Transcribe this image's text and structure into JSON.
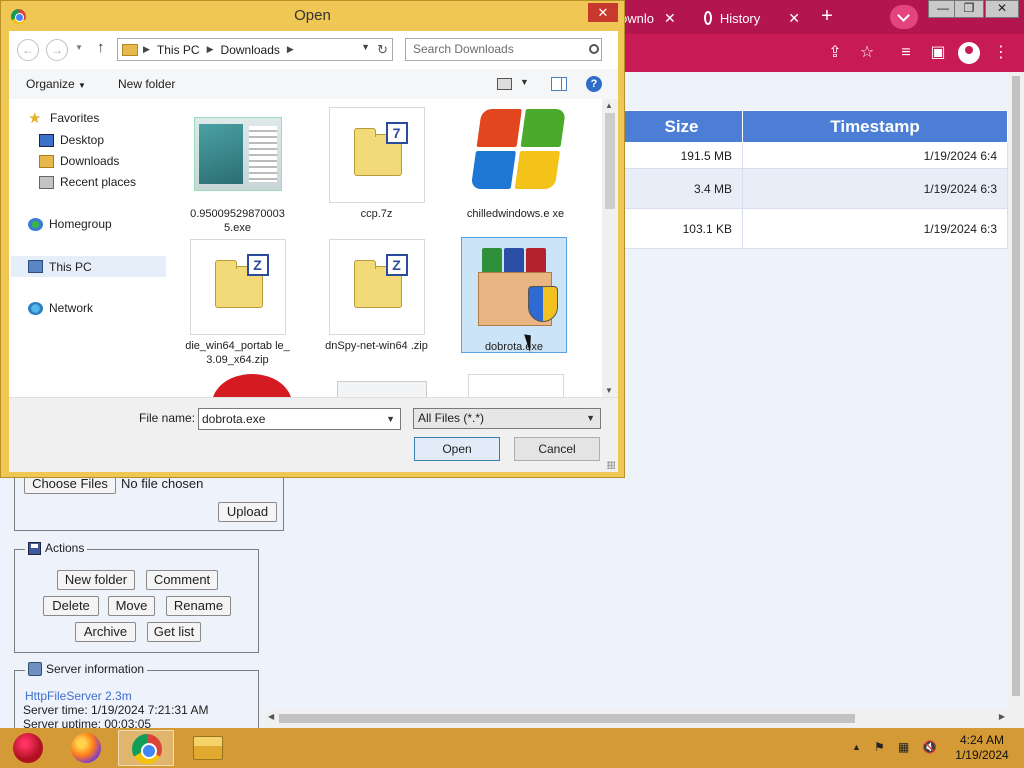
{
  "browser": {
    "tabs": [
      {
        "label": "ownlo"
      },
      {
        "label": "History"
      }
    ],
    "new_tab": "+",
    "window_controls": {
      "close": "✕"
    }
  },
  "page": {
    "table": {
      "headers": [
        "Size",
        "Timestamp"
      ],
      "rows": [
        {
          "size": "191.5 MB",
          "timestamp": "1/19/2024 6:4"
        },
        {
          "size": "3.4 MB",
          "timestamp": "1/19/2024 6:3"
        },
        {
          "size": "103.1 KB",
          "timestamp": "1/19/2024 6:3"
        }
      ]
    },
    "upload": {
      "choose_files": "Choose Files",
      "no_file": "No file chosen",
      "upload_button": "Upload"
    },
    "actions": {
      "title": "Actions",
      "buttons": [
        "New folder",
        "Comment",
        "Delete",
        "Move",
        "Rename",
        "Archive",
        "Get list"
      ]
    },
    "server_info": {
      "title": "Server information",
      "link": "HttpFileServer 2.3m",
      "server_time": "Server time: 1/19/2024 7:21:31 AM",
      "server_uptime": "Server uptime: 00:03:05"
    }
  },
  "dialog": {
    "title": "Open",
    "close": "✕",
    "address": {
      "segments": [
        "This PC",
        "Downloads"
      ]
    },
    "search_placeholder": "Search Downloads",
    "commands": {
      "organize": "Organize",
      "new_folder": "New folder"
    },
    "nav_pane": {
      "favorites": "Favorites",
      "desktop": "Desktop",
      "downloads": "Downloads",
      "recent": "Recent places",
      "homegroup": "Homegroup",
      "this_pc": "This PC",
      "network": "Network"
    },
    "files": [
      {
        "name": "0.95009529870003 5.exe",
        "icon": "exe-thumbnail-icon"
      },
      {
        "name": "ccp.7z",
        "icon": "7z-archive-icon"
      },
      {
        "name": "chilledwindows.e xe",
        "icon": "windows-logo-icon"
      },
      {
        "name": "die_win64_portab le_3.09_x64.zip",
        "icon": "zip-archive-icon"
      },
      {
        "name": "dnSpy-net-win64 .zip",
        "icon": "zip-archive-icon"
      },
      {
        "name": "dobrota.exe",
        "icon": "installer-icon",
        "selected": true
      }
    ],
    "file_name_label": "File name:",
    "file_name_value": "dobrota.exe",
    "file_type": "All Files (*.*)",
    "open_button": "Open",
    "cancel_button": "Cancel"
  },
  "taskbar": {
    "apps": [
      "ornament-app-icon",
      "firefox-icon",
      "chrome-icon",
      "file-explorer-icon"
    ],
    "clock_time": "4:24 AM",
    "clock_date": "1/19/2024"
  }
}
